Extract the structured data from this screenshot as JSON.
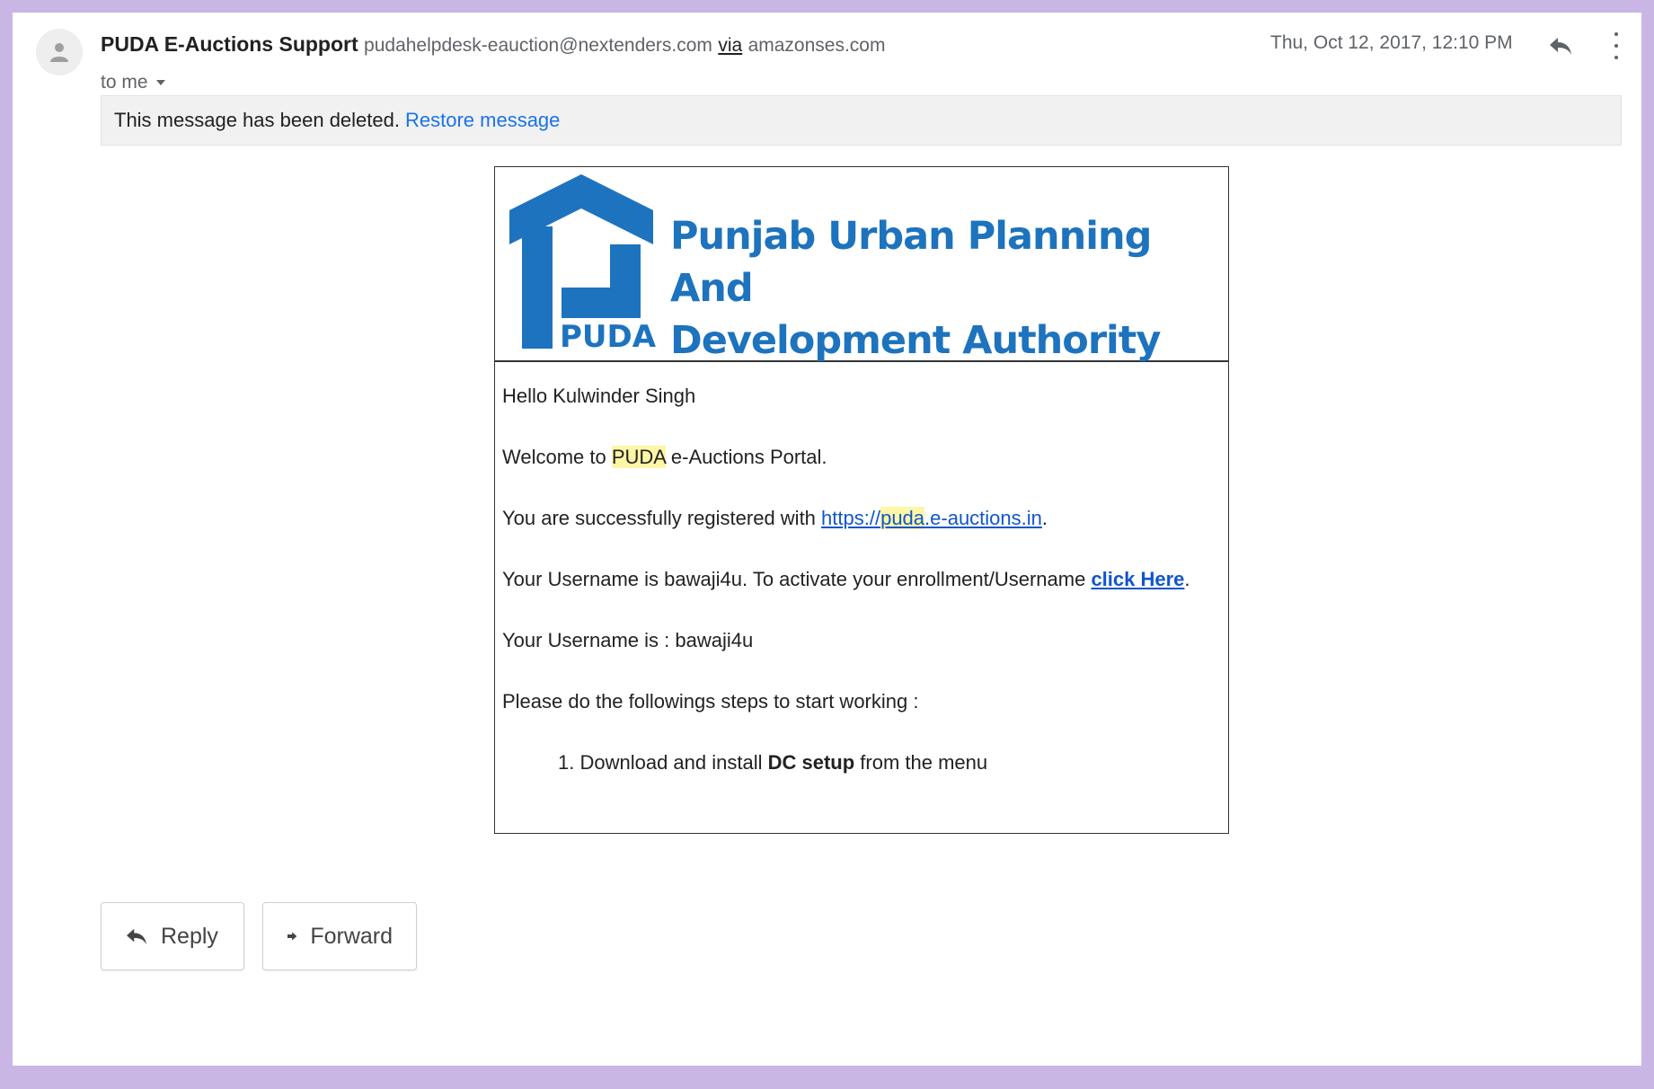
{
  "header": {
    "sender_name": "PUDA E-Auctions Support",
    "sender_email": "pudahelpdesk-eauction@nextenders.com",
    "via_label": "via",
    "via_host": "amazonses.com",
    "to_label": "to me",
    "date": "Thu, Oct 12, 2017, 12:10 PM",
    "icons": {
      "avatar": "person-icon",
      "reply": "reply-arrow-icon",
      "more": "more-vertical-icon",
      "dropdown": "caret-down-icon"
    }
  },
  "deleted_notice": {
    "text": "This message has been deleted.",
    "restore_label": "Restore message"
  },
  "email": {
    "logo_text": "PUDA",
    "org_name_line1": "Punjab Urban Planning And",
    "org_name_line2": "Development Authority",
    "greeting": "Hello Kulwinder Singh",
    "welcome_pre": "Welcome to ",
    "welcome_highlight": "PUDA",
    "welcome_post": " e-Auctions Portal.",
    "registered_pre": "You are successfully registered with ",
    "link_part1": "https://",
    "link_highlight": "puda",
    "link_part2": ".e-auctions.in",
    "registered_post": ".",
    "activate_pre": "Your Username is bawaji4u. To activate your enrollment/Username ",
    "activate_link": "click Here",
    "activate_post": ".",
    "username_line": "Your Username is : bawaji4u",
    "steps_intro": "Please do the followings steps to start working :",
    "step1_pre": "1. Download and install ",
    "step1_bold": "DC setup",
    "step1_post": " from the menu"
  },
  "actions": {
    "reply_label": "Reply",
    "forward_label": "Forward"
  },
  "colors": {
    "frame_border": "#c9b6e4",
    "brand_blue": "#1d73bd",
    "link_blue": "#1155cc",
    "restore_blue": "#1a73e8",
    "highlight": "#fdf6a6"
  }
}
